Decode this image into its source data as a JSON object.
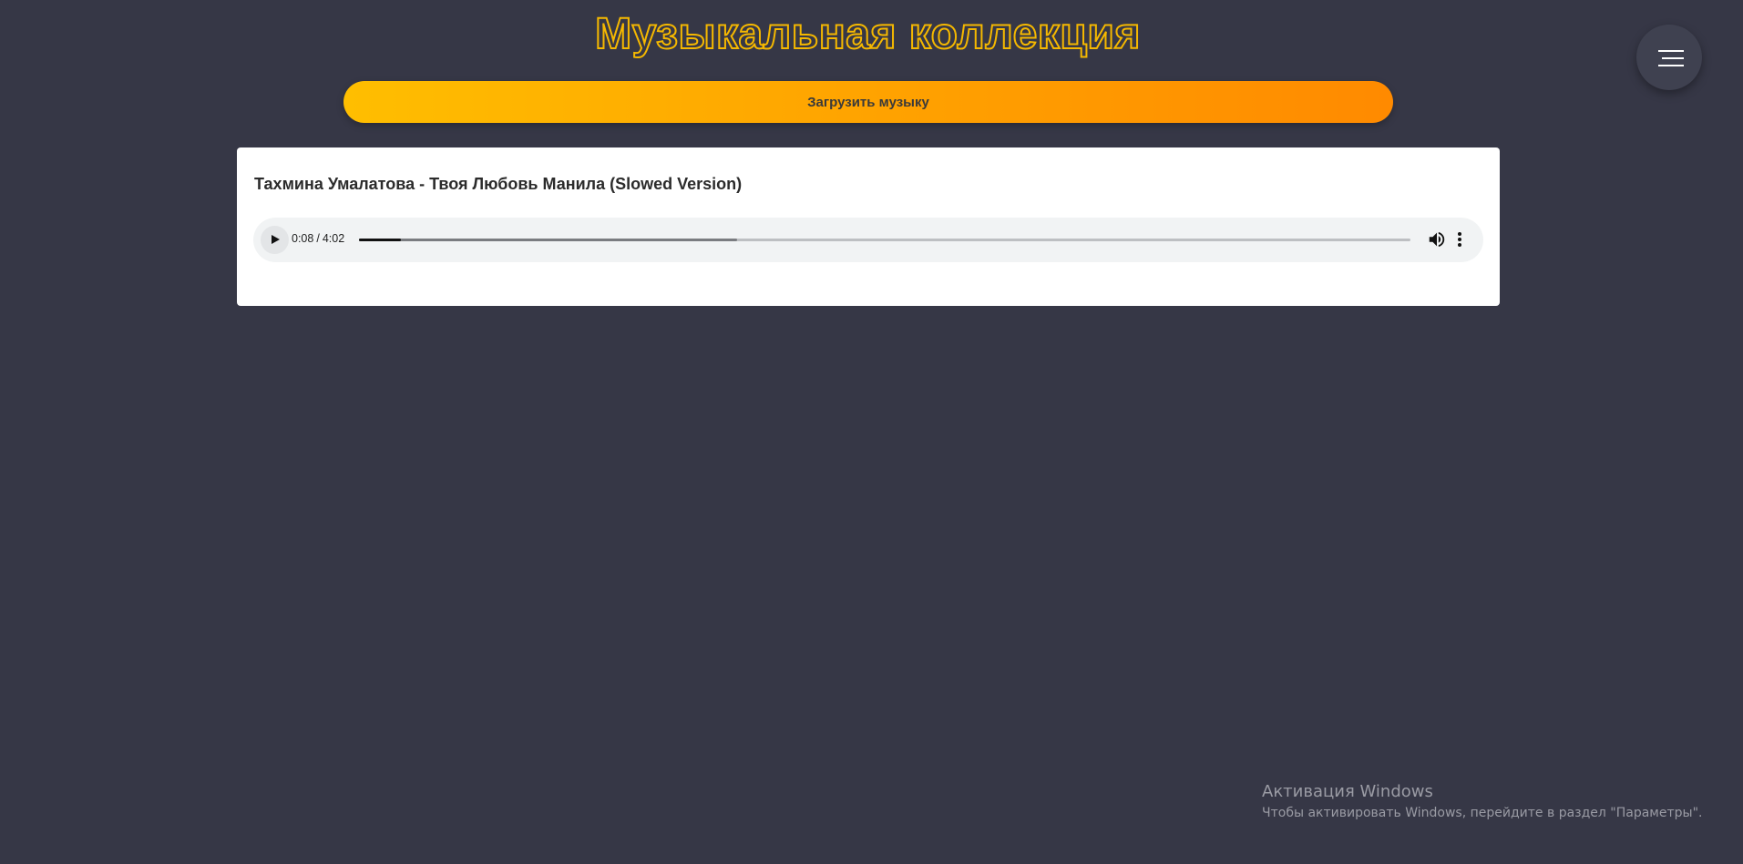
{
  "header": {
    "title": "Музыкальная коллекция",
    "menu_icon": "hamburger-menu-icon"
  },
  "upload": {
    "label": "Загрузить музыку"
  },
  "tracks": [
    {
      "title": "Тахмина Умалатова - Твоя Любовь Манила (Slowed Version)",
      "player": {
        "current_time": "0:08",
        "separator": "/",
        "duration": "4:02",
        "played_fraction": 0.04,
        "buffered_fraction": 0.36,
        "play_icon": "play-icon",
        "volume_icon": "volume-icon",
        "more_icon": "more-options-icon"
      }
    }
  ],
  "watermark": {
    "title": "Активация Windows",
    "subtitle": "Чтобы активировать Windows, перейдите в раздел \"Параметры\"."
  },
  "colors": {
    "background": "#363746",
    "title_outline": "#f5b800",
    "upload_gradient_start": "#ffbe00",
    "upload_gradient_end": "#ff8a00",
    "card": "#ffffff",
    "player_bg": "#f1f3f4"
  }
}
